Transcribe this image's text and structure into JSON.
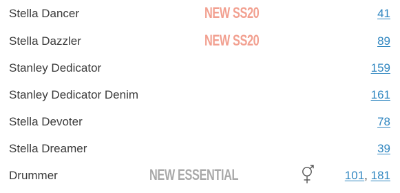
{
  "items": [
    {
      "name": "Stella Dancer",
      "badge": "NEW SS20",
      "pages": [
        "41"
      ]
    },
    {
      "name": "Stella Dazzler",
      "badge": "NEW SS20",
      "pages": [
        "89"
      ]
    },
    {
      "name": "Stanley Dedicator",
      "pages": [
        "159"
      ]
    },
    {
      "name": "Stanley Dedicator Denim",
      "pages": [
        "161"
      ]
    },
    {
      "name": "Stella Devoter",
      "pages": [
        "78"
      ]
    },
    {
      "name": "Stella Dreamer",
      "pages": [
        "39"
      ]
    },
    {
      "name": "Drummer",
      "badge": "NEW ESSENTIAL",
      "icon": "unisex-gender-icon",
      "pages": [
        "101",
        "181"
      ],
      "page_separator": ", "
    }
  ],
  "colors": {
    "text": "#3a3a3a",
    "link": "#2f86c0",
    "badge_ss20": "#f2a090",
    "badge_essential": "#a9a9a9"
  }
}
